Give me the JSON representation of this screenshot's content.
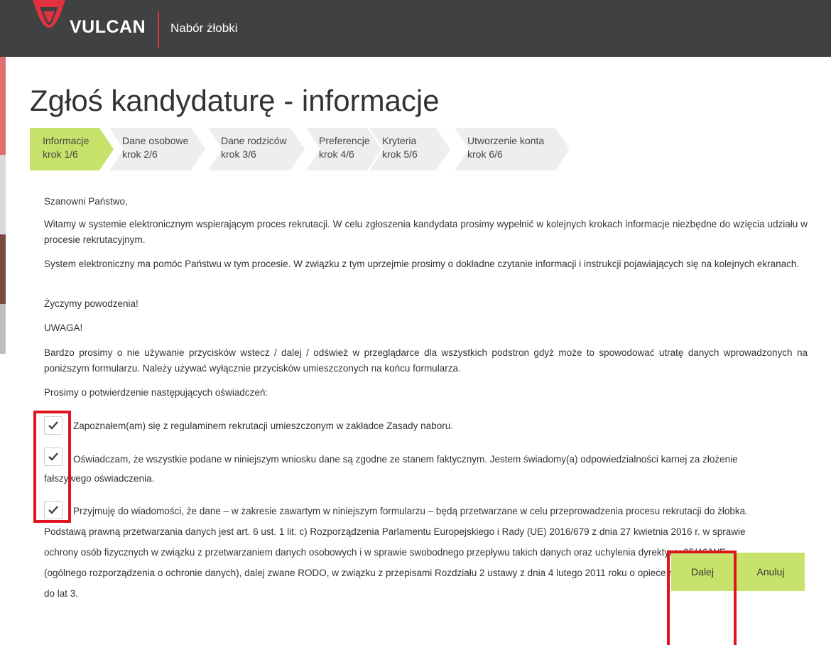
{
  "header": {
    "brand": "VULCAN",
    "app_title": "Nabór żłobki",
    "accent_color": "#e2323f"
  },
  "page_title": "Zgłoś kandydaturę - informacje",
  "steps": [
    {
      "label": "Informacje",
      "sub": "krok 1/6",
      "active": true
    },
    {
      "label": "Dane osobowe",
      "sub": "krok 2/6",
      "active": false
    },
    {
      "label": "Dane rodziców",
      "sub": "krok 3/6",
      "active": false
    },
    {
      "label": "Preferencje",
      "sub": "krok 4/6",
      "active": false
    },
    {
      "label": "Kryteria",
      "sub": "krok 5/6",
      "active": false
    },
    {
      "label": "Utworzenie konta",
      "sub": "krok 6/6",
      "active": false
    }
  ],
  "content": {
    "greeting": "Szanowni Państwo,",
    "para1": "Witamy w systemie elektronicznym wspierającym proces rekrutacji. W celu zgłoszenia kandydata prosimy wypełnić w kolejnych krokach informacje niezbędne do wzięcia udziału w procesie rekrutacyjnym.",
    "para2": "System elektroniczny ma pomóc Państwu w tym procesie. W związku z tym uprzejmie prosimy o dokładne czytanie informacji i instrukcji pojawiających się na kolejnych ekranach.",
    "wish": "Życzymy powodzenia!",
    "warning_title": "UWAGA!",
    "warning_text": "Bardzo prosimy o nie używanie przycisków wstecz / dalej / odśwież w przeglądarce dla wszystkich podstron gdyż może to spowodować utratę danych wprowadzonych na poniższym formularzu. Należy używać wyłącznie przycisków umieszczonych na końcu formularza.",
    "confirm_prompt": "Prosimy o potwierdzenie następujących oświadczeń:"
  },
  "declarations": [
    {
      "checked": true,
      "text": "Zapoznałem(am) się z regulaminem rekrutacji umieszczonym w zakładce Zasady naboru."
    },
    {
      "checked": true,
      "text": "Oświadczam, że wszystkie podane w niniejszym wniosku dane są zgodne ze stanem faktycznym. Jestem świadomy(a) odpowiedzialności karnej za złożenie fałszywego oświadczenia."
    },
    {
      "checked": true,
      "text": "Przyjmuję do wiadomości, że dane – w zakresie zawartym w niniejszym formularzu – będą przetwarzane w celu przeprowadzenia procesu rekrutacji do żłobka. Podstawą prawną przetwarzania danych jest art. 6 ust. 1 lit. c) Rozporządzenia Parlamentu Europejskiego i Rady (UE) 2016/679 z dnia 27 kwietnia 2016 r. w sprawie ochrony osób fizycznych w związku z przetwarzaniem danych osobowych i w sprawie swobodnego przepływu takich danych oraz uchylenia dyrektywy 95/46/WE (ogólnego rozporządzenia o ochronie danych), dalej zwane RODO, w związku z przepisami Rozdziału 2 ustawy z dnia 4 lutego 2011 roku o opiece nad dziećmi w wieku do lat 3."
    }
  ],
  "buttons": {
    "next": "Dalej",
    "cancel": "Anuluj",
    "button_color": "#c7e36b"
  },
  "highlight_color": "#e0141e"
}
